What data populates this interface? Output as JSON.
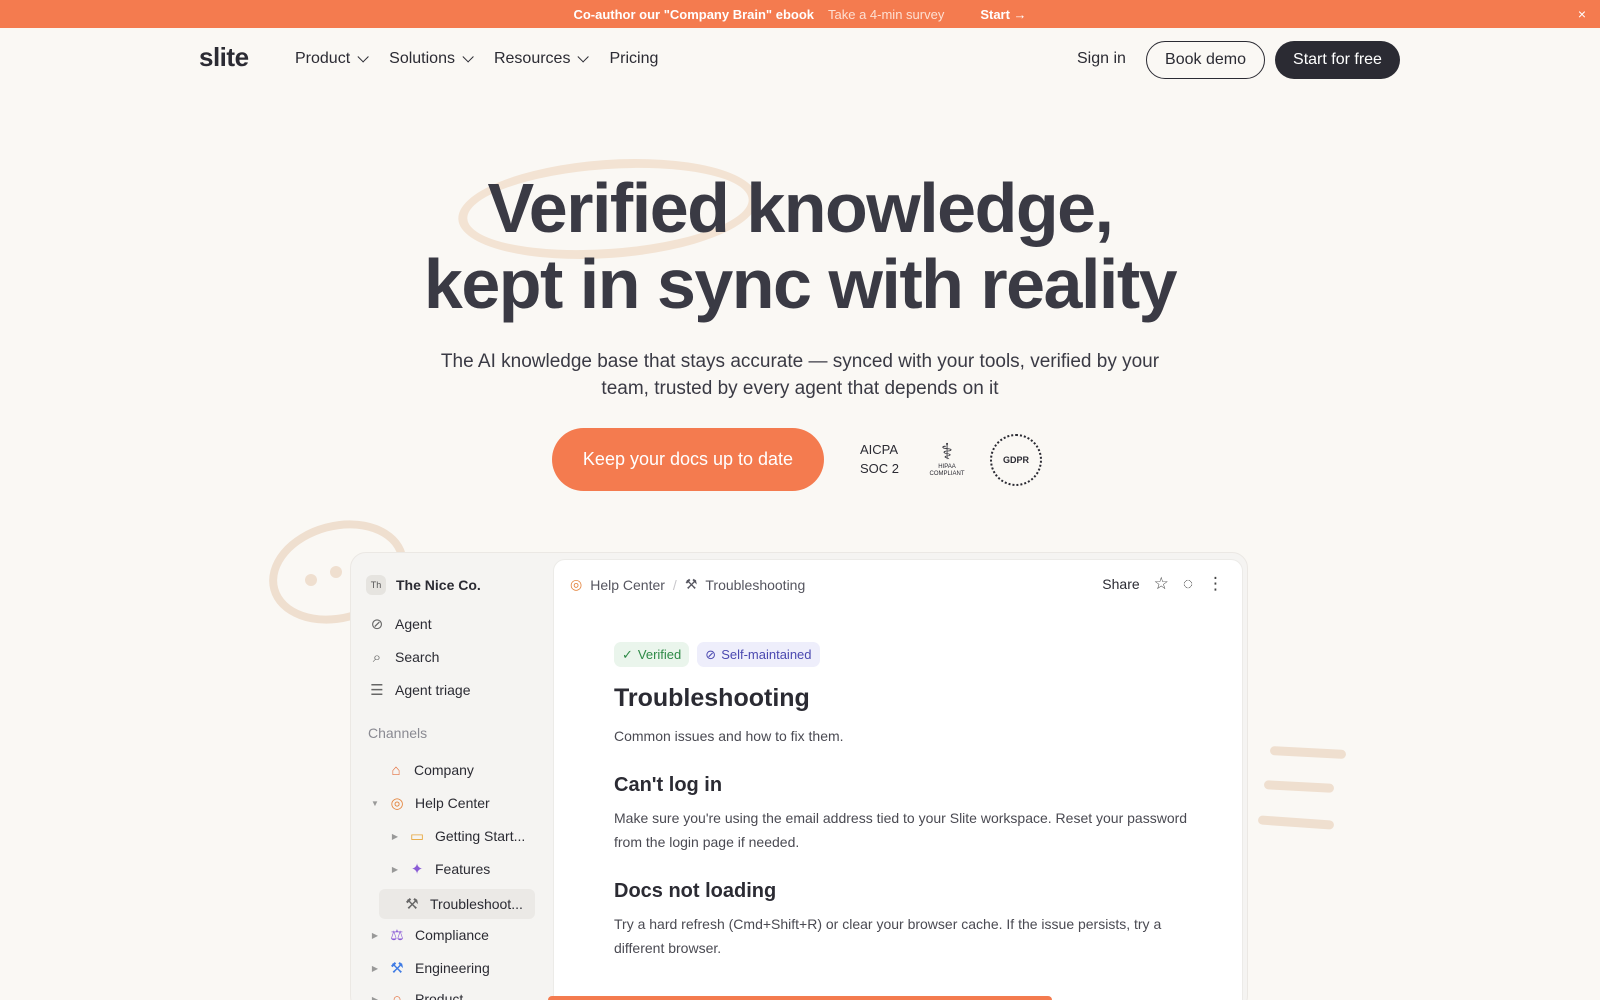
{
  "announcement": {
    "headline": "Co-author our \"Company Brain\" ebook",
    "sub": "Take a 4-min survey",
    "start_label": "Start →",
    "close_icon": "×"
  },
  "nav": {
    "logo": "slite",
    "menu": [
      {
        "label": "Product"
      },
      {
        "label": "Solutions"
      },
      {
        "label": "Resources"
      },
      {
        "label": "Pricing"
      }
    ],
    "sign_in": "Sign in",
    "book_demo": "Book demo",
    "start_free": "Start for free"
  },
  "hero": {
    "title_line1": "Verified knowledge,",
    "title_line2": "kept in sync with reality",
    "subtitle": "The AI knowledge base that stays accurate — synced with your tools, verified by your team, trusted by every agent that depends on it",
    "cta": "Keep your docs up to date",
    "badges": {
      "aicpa_line1": "AICPA",
      "aicpa_line2": "SOC 2",
      "hipaa": "HIPAA COMPLIANT",
      "gdpr": "GDPR"
    }
  },
  "app": {
    "workspace": {
      "initials": "Th",
      "name": "The Nice Co."
    },
    "nav_items": [
      {
        "label": "Agent",
        "icon": "agent-icon"
      },
      {
        "label": "Search",
        "icon": "search-icon"
      },
      {
        "label": "Agent triage",
        "icon": "triage-icon"
      }
    ],
    "channels_label": "Channels",
    "channels": [
      {
        "label": "Company",
        "icon": "home-icon"
      },
      {
        "label": "Help Center",
        "icon": "lifebuoy-icon"
      },
      {
        "label": "Getting Start...",
        "icon": "folder-icon"
      },
      {
        "label": "Features",
        "icon": "sparkle-icon"
      },
      {
        "label": "Troubleshoot...",
        "icon": "wrench-icon"
      },
      {
        "label": "Compliance",
        "icon": "scale-icon"
      },
      {
        "label": "Engineering",
        "icon": "hammer-icon"
      },
      {
        "label": "Product",
        "icon": "bulb-icon"
      }
    ],
    "breadcrumb": [
      "Help Center",
      "Troubleshooting"
    ],
    "share": "Share",
    "tags": {
      "verified": "Verified",
      "self_maintained": "Self-maintained"
    },
    "doc": {
      "title": "Troubleshooting",
      "intro": "Common issues and how to fix them.",
      "sections": [
        {
          "heading": "Can't log in",
          "body": "Make sure you're using the email address tied to your Slite workspace. Reset your password from the login page if needed."
        },
        {
          "heading": "Docs not loading",
          "body": "Try a hard refresh (Cmd+Shift+R) or clear your browser cache. If the issue persists, try a different browser."
        }
      ]
    },
    "colors": {
      "accent": "#f47b4f",
      "dark": "#2b2b33"
    }
  }
}
